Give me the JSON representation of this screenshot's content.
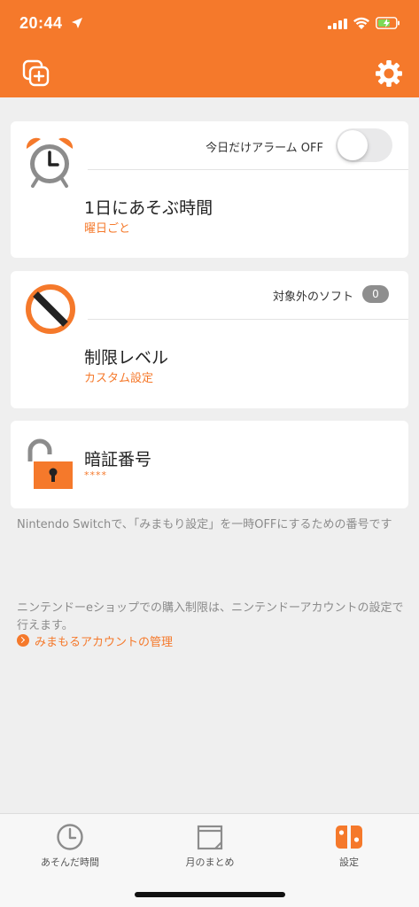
{
  "status_bar": {
    "time": "20:44"
  },
  "colors": {
    "accent": "#f5792b",
    "header_bg": "#f5792b",
    "badge_bg": "#8e8e8e",
    "page_bg": "#efefef"
  },
  "header": {
    "left_icon": "add-profile-icon",
    "right_icon": "gear-icon"
  },
  "timer_card": {
    "alarm_toggle_label": "今日だけアラーム OFF",
    "alarm_toggle_on": false,
    "title": "1日にあそぶ時間",
    "subtitle": "曜日ごと",
    "icon": "alarm-clock-icon"
  },
  "restriction_card": {
    "excluded_label": "対象外のソフト",
    "excluded_count": "0",
    "title": "制限レベル",
    "subtitle": "カスタム設定",
    "icon": "prohibited-icon"
  },
  "pin_card": {
    "title": "暗証番号",
    "masked_value": "****",
    "icon": "unlocked-padlock-icon"
  },
  "pin_help": "Nintendo Switchで、「みまもり設定」を一時OFFにするための番号です",
  "eshop_help": "ニンテンドーeショップでの購入制限は、ニンテンドーアカウントの設定で行えます。",
  "eshop_link": "みまもるアカウントの管理",
  "tabs": [
    {
      "label": "あそんだ時間",
      "icon": "clock-icon",
      "active": false
    },
    {
      "label": "月のまとめ",
      "icon": "calendar-icon",
      "active": false
    },
    {
      "label": "設定",
      "icon": "switch-console-icon",
      "active": true
    }
  ]
}
